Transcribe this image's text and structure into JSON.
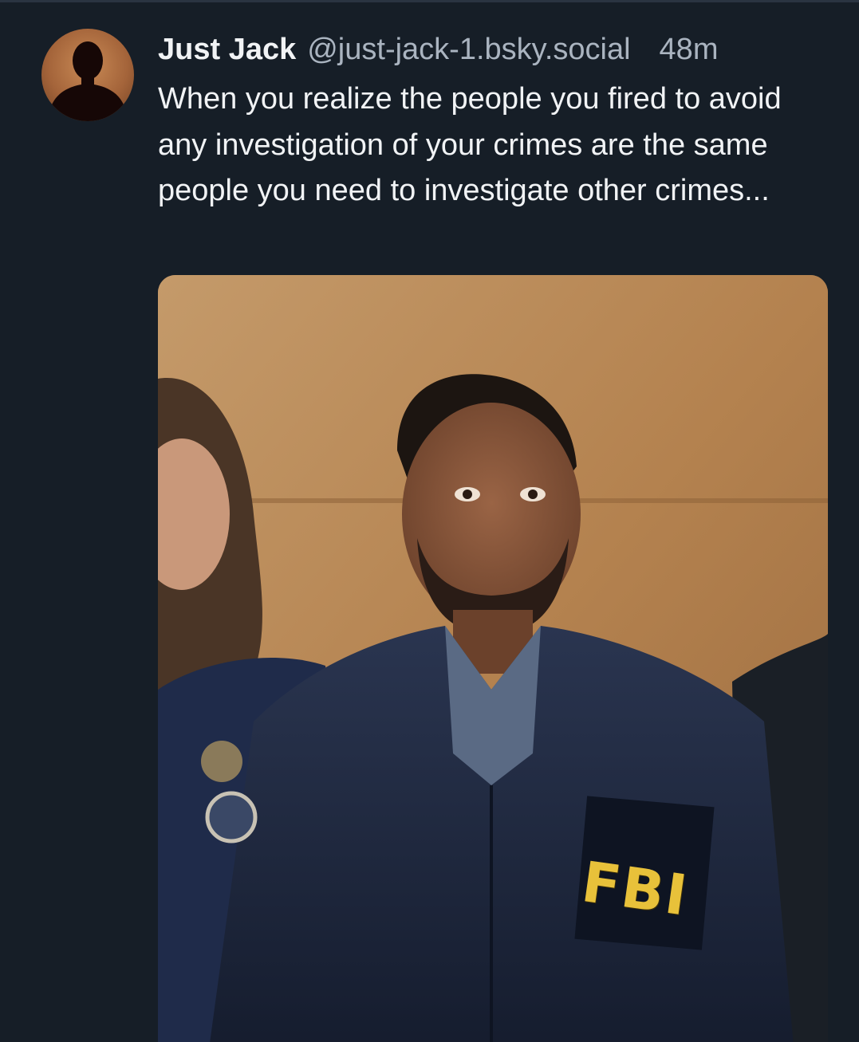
{
  "post": {
    "author": {
      "display_name": "Just Jack",
      "handle": "@just-jack-1.bsky.social",
      "avatar_icon": "silhouette-avatar"
    },
    "timestamp": "48m",
    "text": "When you realize the people you fired to avoid any investigation of your crimes are the same people you need to investigate other crimes...",
    "media": {
      "jacket_text": "FBI"
    }
  },
  "colors": {
    "background": "#161e27",
    "primary_text": "#f1f3f5",
    "secondary_text": "#aab4c0",
    "fbi_lettering": "#e8c13a"
  }
}
